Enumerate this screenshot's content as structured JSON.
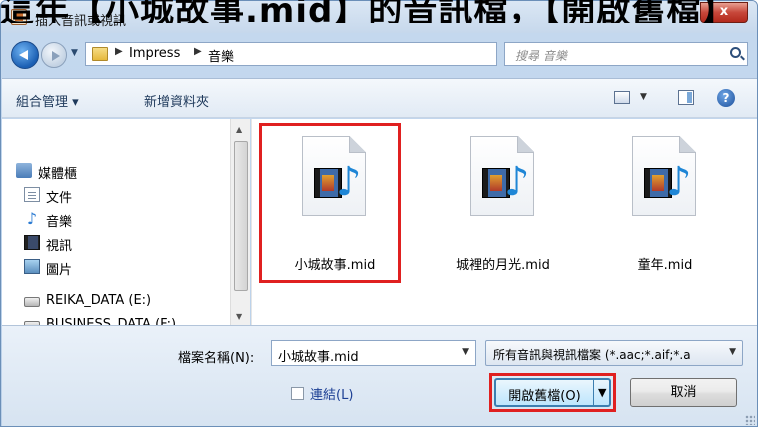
{
  "caption": "這年【小城故事.mid】的音訊檔，【開啟舊檔】",
  "window": {
    "title": "插入音訊或視訊",
    "close": "x"
  },
  "address": {
    "crumbs": [
      "Impress",
      "音樂"
    ],
    "search_placeholder": "搜尋 音樂"
  },
  "toolbar": {
    "organize": "組合管理 ▾",
    "new_folder": "新增資料夾"
  },
  "nav": {
    "items": [
      {
        "label": "媒體櫃",
        "icon": "library-icon"
      },
      {
        "label": "文件",
        "icon": "documents-icon"
      },
      {
        "label": "音樂",
        "icon": "music-icon"
      },
      {
        "label": "視訊",
        "icon": "video-icon"
      },
      {
        "label": "圖片",
        "icon": "pictures-icon"
      },
      {
        "label": "REIKA_DATA (E:)",
        "icon": "drive-icon"
      },
      {
        "label": "BUSINESS_DATA (F:)",
        "icon": "drive-icon"
      }
    ]
  },
  "files": [
    {
      "name": "小城故事.mid",
      "selected": true
    },
    {
      "name": "城裡的月光.mid",
      "selected": false
    },
    {
      "name": "童年.mid",
      "selected": false
    }
  ],
  "bottom": {
    "filename_label": "檔案名稱(N):",
    "filename_value": "小城故事.mid",
    "filetype_value": "所有音訊與視訊檔案 (*.aac;*.aif;*.a",
    "link_label": "連結(L)",
    "open_label": "開啟舊檔(O)",
    "cancel_label": "取消"
  },
  "colors": {
    "highlight": "#e02020",
    "accent": "#1f86d6"
  }
}
